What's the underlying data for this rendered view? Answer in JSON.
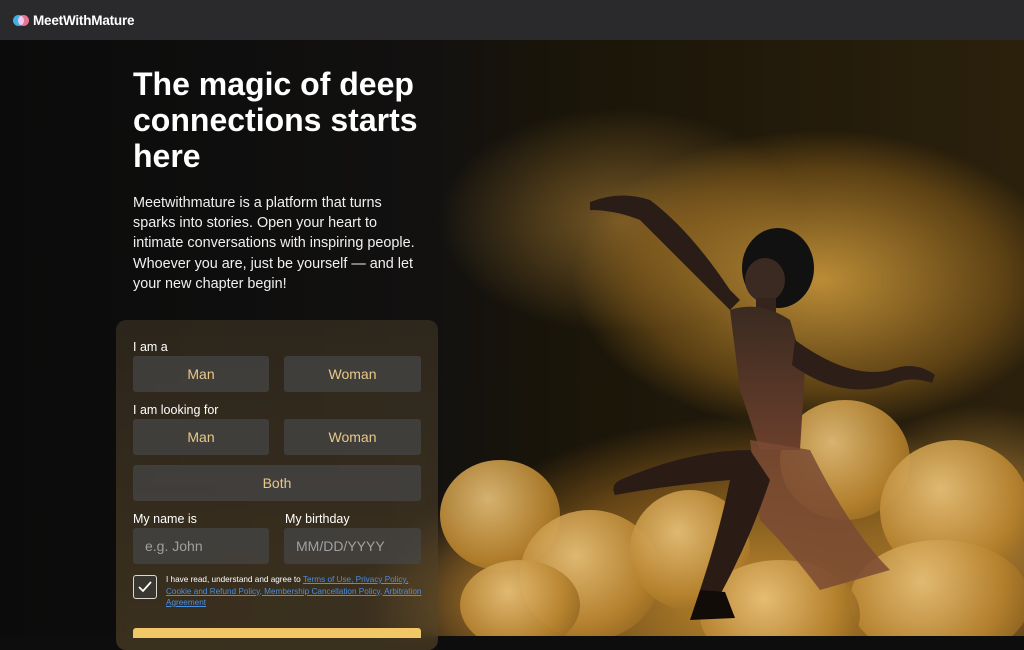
{
  "header": {
    "logo_text": "MeetWithMature",
    "logo_icon": "logo-mark-icon"
  },
  "hero": {
    "title": "The magic of deep connections starts here",
    "intro": "Meetwithmature is a platform that turns sparks into stories. Open your heart to intimate conversations with inspiring people. Whoever you are, just be yourself — and let your new chapter begin!"
  },
  "form": {
    "i_am_label": "I am a",
    "i_am_options": [
      "Man",
      "Woman"
    ],
    "looking_for_label": "I am looking for",
    "looking_for_options": [
      "Man",
      "Woman",
      "Both"
    ],
    "name_label": "My name is",
    "name_placeholder": "e.g. John",
    "birthday_label": "My birthday",
    "birthday_placeholder": "MM/DD/YYYY",
    "terms_prefix": "I have read, understand and agree to",
    "terms_links": "Terms of Use, Privacy Policy, Cookie and Refund Policy, Membership Cancellation Policy, Arbitration Agreement",
    "terms_checked": true
  },
  "colors": {
    "accent_text": "#e8c98a",
    "submit": "#f2c766",
    "topbar": "#2a2a2c"
  }
}
